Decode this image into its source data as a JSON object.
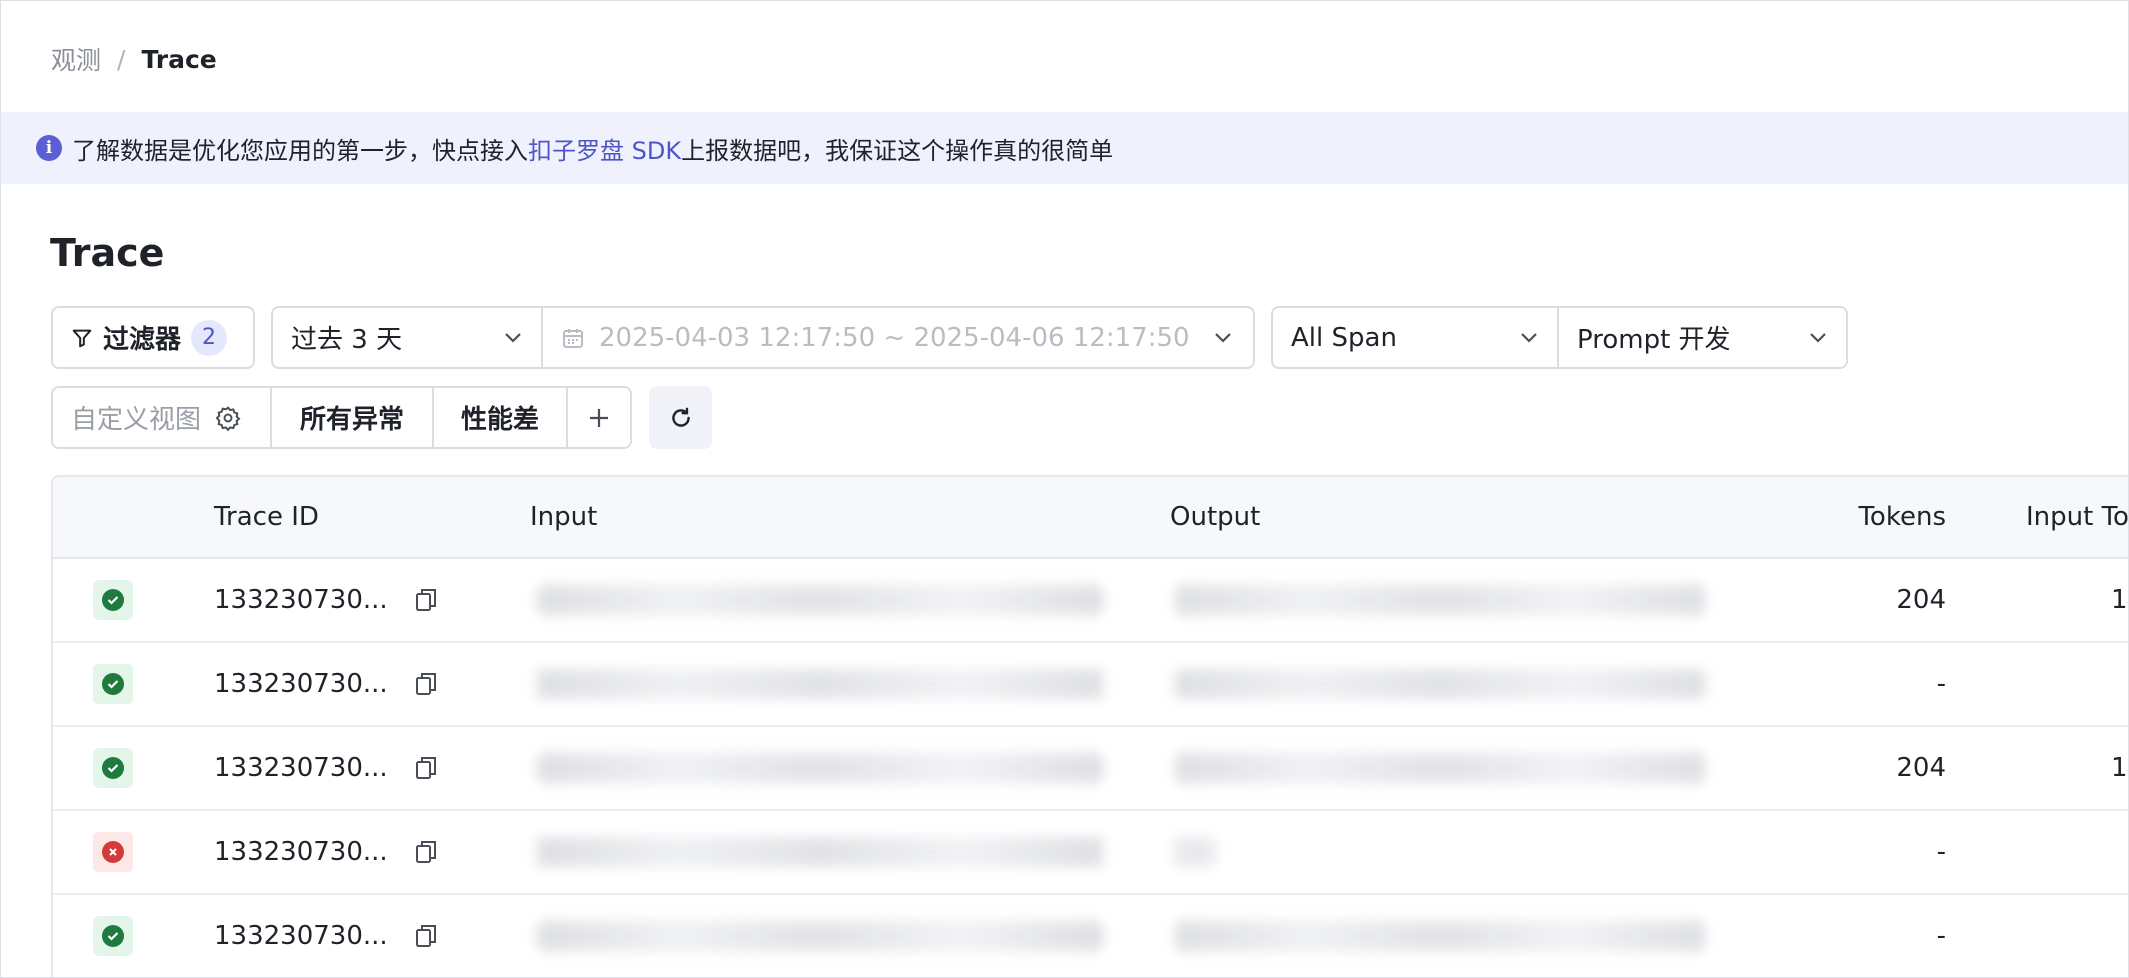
{
  "breadcrumb": {
    "parent": "观测",
    "separator": "/",
    "current": "Trace"
  },
  "banner": {
    "text_before": "了解数据是优化您应用的第一步，快点接入 ",
    "link": "扣子罗盘 SDK",
    "text_after": " 上报数据吧，我保证这个操作真的很简单",
    "icon": "info-icon"
  },
  "page": {
    "title": "Trace"
  },
  "filters": {
    "filter_label": "过滤器",
    "filter_count": "2",
    "time_range": "过去 3 天",
    "date_range": "2025-04-03 12:17:50 ~ 2025-04-06 12:17:50",
    "span_type": "All Span",
    "platform": "Prompt 开发"
  },
  "views": {
    "custom_placeholder": "自定义视图",
    "tabs": [
      "所有异常",
      "性能差"
    ],
    "add_label": "+"
  },
  "table": {
    "columns": [
      "Trace ID",
      "Input",
      "Output",
      "Tokens",
      "Input To"
    ],
    "rows": [
      {
        "status": "success",
        "trace_id": "133230730...",
        "tokens": "204",
        "input_tokens": "1"
      },
      {
        "status": "success",
        "trace_id": "133230730...",
        "tokens": "-",
        "input_tokens": ""
      },
      {
        "status": "success",
        "trace_id": "133230730...",
        "tokens": "204",
        "input_tokens": "1"
      },
      {
        "status": "error",
        "trace_id": "133230730...",
        "tokens": "-",
        "input_tokens": ""
      },
      {
        "status": "success",
        "trace_id": "133230730...",
        "tokens": "-",
        "input_tokens": ""
      }
    ]
  },
  "colors": {
    "accent": "#4e55c9",
    "banner_bg": "#eff2fd",
    "success": "#1f7a3d",
    "error": "#d43a3a"
  }
}
